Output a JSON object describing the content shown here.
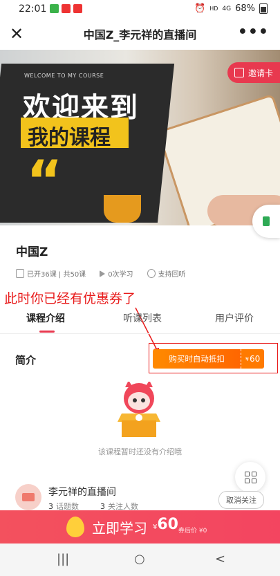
{
  "status_bar": {
    "time": "22:01",
    "network": "HD",
    "signal": "4G",
    "battery": "68%"
  },
  "header": {
    "title": "中国Z_李元祥的直播间",
    "close_icon": "close-icon",
    "more_icon": "more-icon",
    "more_glyph": "•••"
  },
  "banner": {
    "welcome": "WELCOME TO MY COURSE",
    "line1": "欢迎来到",
    "line2": "我的课程",
    "invite_label": "邀请卡"
  },
  "course": {
    "name": "中国Z",
    "lessons": "已开36课 | 共50课",
    "views": "0次学习",
    "replay": "支持回听"
  },
  "annotation": {
    "text": "此时你已经有优惠券了",
    "color": "#e81a1a"
  },
  "tabs": [
    {
      "label": "课程介绍",
      "active": true
    },
    {
      "label": "听课列表",
      "active": false
    },
    {
      "label": "用户评价",
      "active": false
    }
  ],
  "intro": {
    "title": "简介",
    "coupon_label": "购买时自动抵扣",
    "coupon_currency": "¥",
    "coupon_value": "60",
    "empty_text": "该课程暂时还没有介绍哦"
  },
  "author": {
    "name": "李元祥的直播间",
    "topics_count": "3",
    "topics_label": "话题数",
    "followers_count": "3",
    "followers_label": "关注人数",
    "unfollow_label": "取消关注"
  },
  "buy_bar": {
    "label": "立即学习",
    "currency": "¥",
    "price": "60",
    "after_label": "券后价 ¥0"
  },
  "nav_bar": {
    "menu": "|||",
    "home": "○",
    "back": "<"
  },
  "colors": {
    "accent": "#e8394f",
    "coupon": "#ff7a00",
    "annotation": "#e81a1a"
  }
}
